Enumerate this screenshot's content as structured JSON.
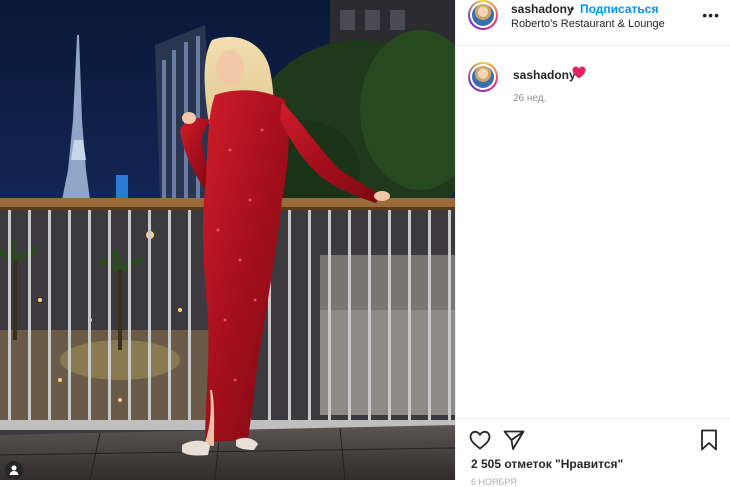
{
  "post": {
    "username": "sashadony",
    "separator": "•",
    "follow_label": "Подписаться",
    "location": "Roberto's Restaurant & Lounge"
  },
  "comment": {
    "username": "sashadony",
    "emoji": "heart-icon",
    "time": "26 нед."
  },
  "footer": {
    "likes_text": "2 505 отметок \"Нравится\"",
    "partial_text": "6 НОЯБРЯ"
  },
  "icons": {
    "more": "more-options-icon",
    "like": "heart-outline-icon",
    "share": "paper-plane-icon",
    "save": "bookmark-icon",
    "user_badge": "user-icon"
  },
  "colors": {
    "accent": "#0095f6",
    "heart": "#e0245e",
    "dress": "#b3121f"
  }
}
